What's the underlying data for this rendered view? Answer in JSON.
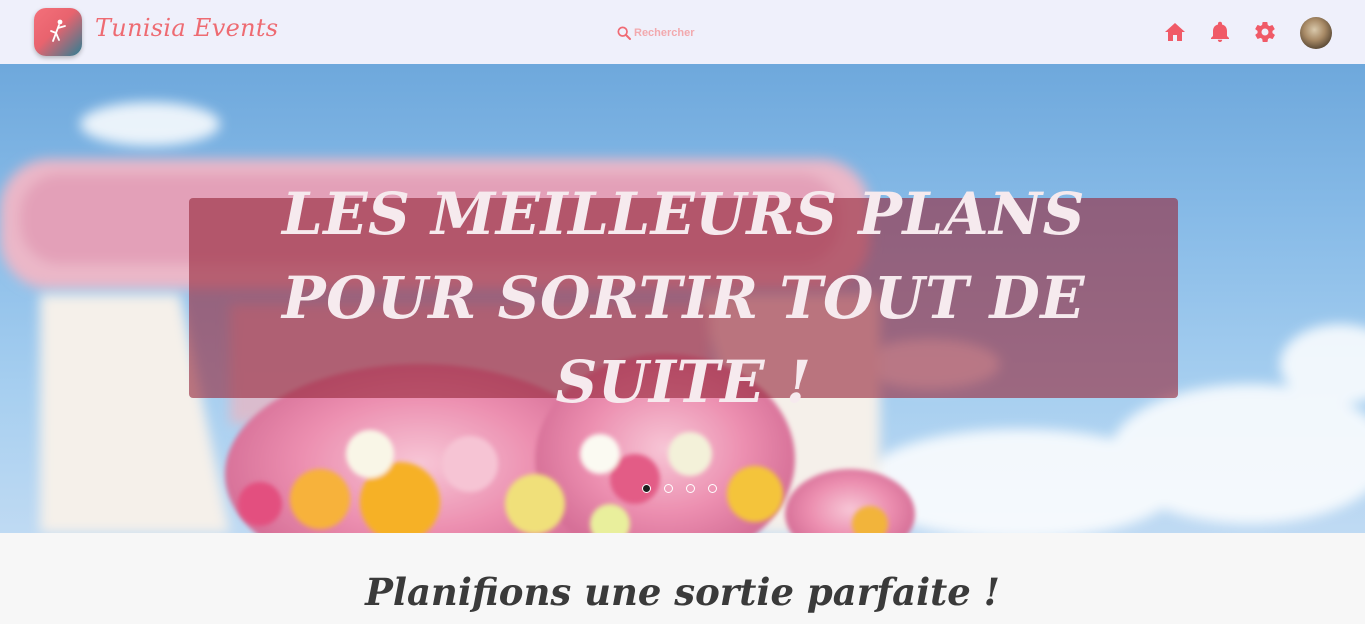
{
  "header": {
    "brand": "Tunisia Events",
    "search_placeholder": "Rechercher",
    "icons": [
      "home-icon",
      "bell-icon",
      "gear-icon"
    ],
    "accent_color": "#f05a67"
  },
  "hero": {
    "headline": "LES MEILLEURS PLANS POUR SORTIR TOUT DE SUITE !",
    "slides_total": 4,
    "active_slide": 1
  },
  "section": {
    "title": "Planifions une sortie parfaite !"
  }
}
